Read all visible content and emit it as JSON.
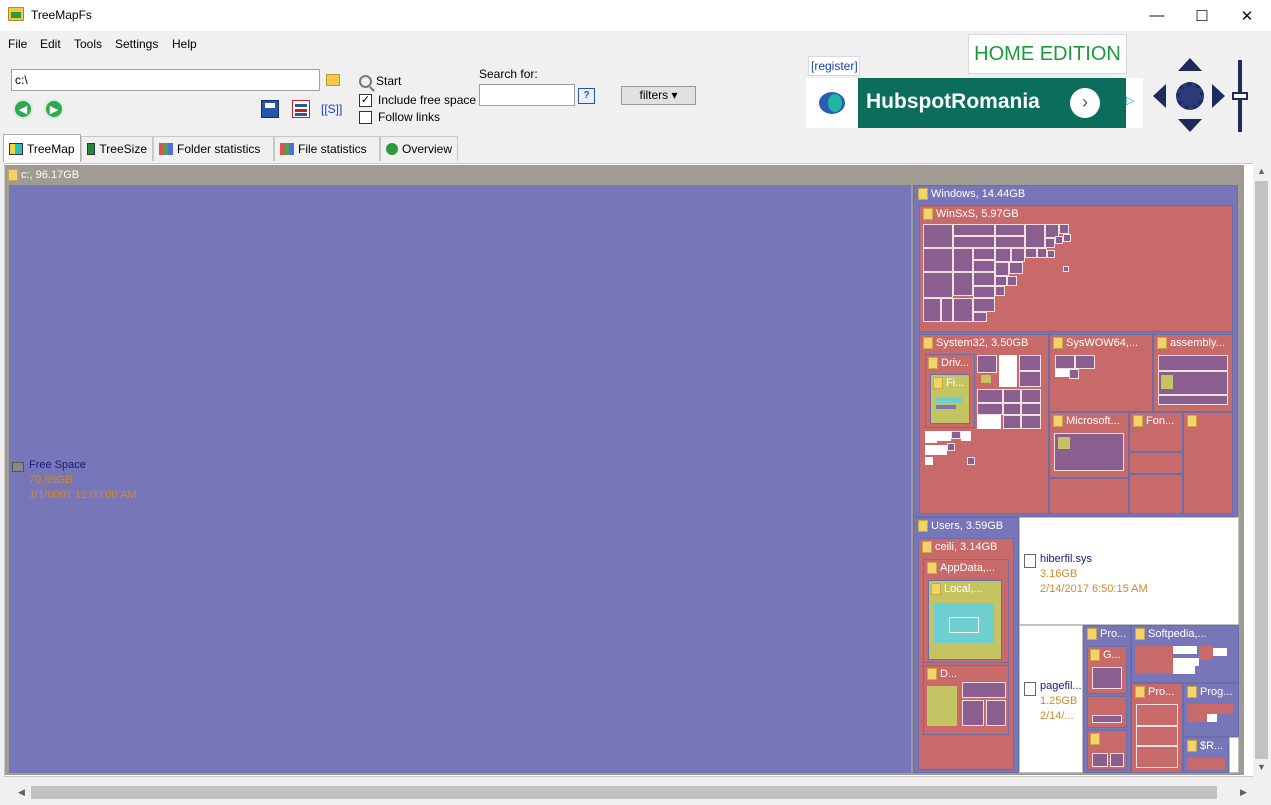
{
  "window": {
    "title": "TreeMapFs",
    "minimize": "—",
    "maximize": "☐",
    "close": "✕"
  },
  "menu": [
    "File",
    "Edit",
    "Tools",
    "Settings",
    "Help"
  ],
  "toolbar": {
    "path_value": "c:\\",
    "start_label": "Start",
    "include_free_space_label": "Include free space",
    "include_free_space_checked": true,
    "follow_links_label": "Follow links",
    "follow_links_checked": false,
    "search_label": "Search for:",
    "search_value": "",
    "help_label": "?",
    "filters_label": "filters ▾",
    "s_link": "[[S]]",
    "back_icon": "back-arrow-icon",
    "forward_icon": "forward-arrow-icon"
  },
  "ad": {
    "register": "[register]",
    "edition": "HOME EDITION",
    "banner_text": "HubspotRomania",
    "arrow": "›",
    "choices": "▷"
  },
  "tabs": [
    {
      "label": "TreeMap",
      "active": true,
      "icon": "treemap-icon"
    },
    {
      "label": "TreeSize",
      "active": false,
      "icon": "treesize-icon"
    },
    {
      "label": "Folder statistics",
      "active": false,
      "icon": "bar-chart-icon"
    },
    {
      "label": "File statistics",
      "active": false,
      "icon": "bar-chart-icon"
    },
    {
      "label": "Overview",
      "active": false,
      "icon": "overview-icon"
    }
  ],
  "treemap": {
    "root": "c:, 96.17GB",
    "free_space": {
      "name": "Free Space",
      "size": "70.65GB",
      "date": "1/1/0001 12:00:00 AM"
    },
    "windows": "Windows, 14.44GB",
    "winsxs": "WinSxS, 5.97GB",
    "system32": "System32, 3.50GB",
    "driv": "Driv...",
    "fi": "Fi...",
    "syswow64": "SysWOW64,...",
    "assembly": "assembly...",
    "microsoft": "Microsoft...",
    "fon": "Fon...",
    "users": "Users, 3.59GB",
    "ceili": "ceili, 3.14GB",
    "appdata": "AppData,...",
    "local": "Local,...",
    "d": "D...",
    "hiberfil": {
      "name": "hiberfil.sys",
      "size": "3.16GB",
      "date": "2/14/2017 6:50:15 AM"
    },
    "pagefile": {
      "name": "pagefil...",
      "size": "1.25GB",
      "date": "2/14/..."
    },
    "pro1": "Pro...",
    "softpedia": "Softpedia,...",
    "g": "G...",
    "pro2": "Pro...",
    "prog": "Prog...",
    "r": "$R..."
  },
  "colors": {
    "free_space": "#7676b8",
    "folder_red": "#c96a6a",
    "folder_olive": "#c4c462",
    "accent_green": "#1c9a3a"
  }
}
